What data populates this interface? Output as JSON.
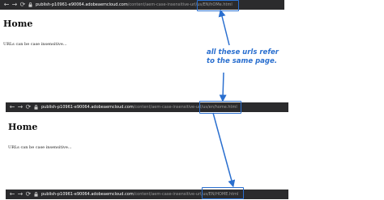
{
  "tabs": [
    {
      "nav": {
        "back": "←",
        "forward": "→",
        "reload": "⟳"
      },
      "url_domain": "publish-p10961-e90064.adobeaemcloud.com",
      "url_path": "/content/aem-case-insensitive-url/us/EN/hOMe.html"
    },
    {
      "nav": {
        "back": "←",
        "forward": "→",
        "reload": "⟳"
      },
      "url_domain": "publish-p10961-e90064.adobeaemcloud.com",
      "url_path": "/content/aem-case-insensitive-url/us/en/home.html"
    },
    {
      "nav": {
        "back": "←",
        "forward": "→",
        "reload": "⟳"
      },
      "url_domain": "publish-p10961-e90064.adobeaemcloud.com",
      "url_path": "/content/aem-case-insensitive-url/us/EN/HOME.html"
    }
  ],
  "pages": [
    {
      "heading": "Home",
      "text": "URLs can be case insensitive..."
    },
    {
      "heading": "Home",
      "text": "URLs can be case insensitive..."
    }
  ],
  "annotation": {
    "line1": "all these urls refer",
    "line2": "to the same page."
  },
  "colors": {
    "highlight": "#2a6fcf",
    "bar": "#2b2b2d"
  }
}
